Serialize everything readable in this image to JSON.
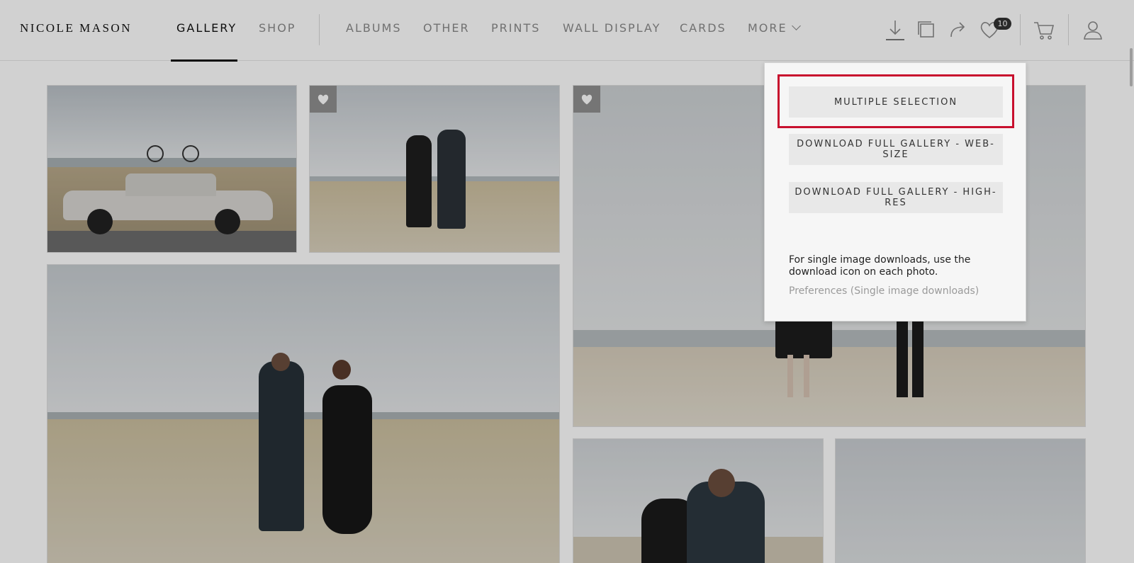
{
  "brand": "NICOLE MASON",
  "nav": {
    "gallery": "GALLERY",
    "shop": "SHOP",
    "albums": "ALBUMS",
    "other": "OTHER",
    "prints": "PRINTS",
    "wall_display": "WALL DISPLAY",
    "cards": "CARDS",
    "more": "MORE"
  },
  "header_icons": {
    "download": "download-icon",
    "slideshow": "slideshow-icon",
    "share": "share-icon",
    "favorites": "heart-icon",
    "favorites_count": "10",
    "cart": "cart-icon",
    "account": "user-icon"
  },
  "download_menu": {
    "multiple_selection": "MULTIPLE SELECTION",
    "web_size": "DOWNLOAD FULL GALLERY - WEB-SIZE",
    "high_res": "DOWNLOAD FULL GALLERY - HIGH-RES",
    "note": "For single image downloads, use the download icon on each photo.",
    "preferences_link": "Preferences (Single image downloads)"
  },
  "colors": {
    "highlight": "#c8102e",
    "active_text": "#111111",
    "muted_text": "#8a8a8a"
  }
}
